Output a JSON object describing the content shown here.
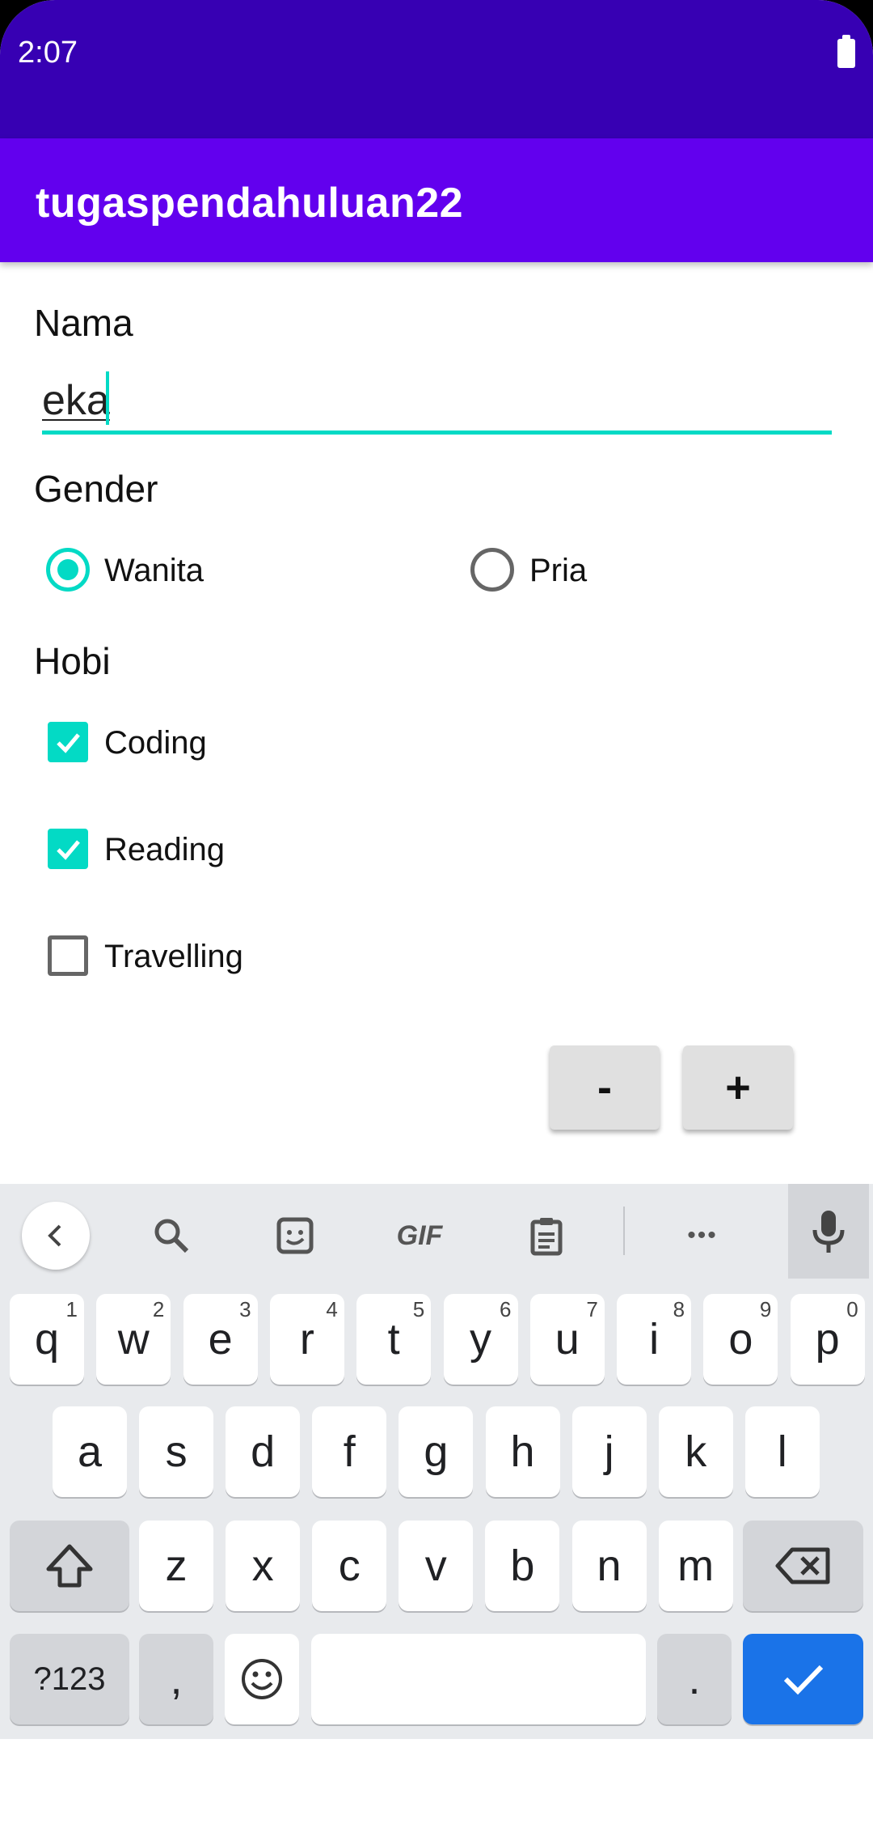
{
  "status_bar": {
    "time": "2:07"
  },
  "app_bar": {
    "title": "tugaspendahuluan22"
  },
  "form": {
    "name_label": "Nama",
    "name_value": "eka",
    "gender_label": "Gender",
    "gender_options": [
      {
        "label": "Wanita",
        "checked": true
      },
      {
        "label": "Pria",
        "checked": false
      }
    ],
    "hobby_label": "Hobi",
    "hobbies": [
      {
        "label": "Coding",
        "checked": true
      },
      {
        "label": "Reading",
        "checked": true
      },
      {
        "label": "Travelling",
        "checked": false
      }
    ],
    "minus_label": "-",
    "plus_label": "+"
  },
  "keyboard": {
    "toolbar": [
      "back-icon",
      "search-icon",
      "sticker-icon",
      "gif-icon",
      "clipboard-icon",
      "more-icon",
      "mic-icon"
    ],
    "gif_label": "GIF",
    "more_label": "•••",
    "row1": [
      {
        "k": "q",
        "h": "1"
      },
      {
        "k": "w",
        "h": "2"
      },
      {
        "k": "e",
        "h": "3"
      },
      {
        "k": "r",
        "h": "4"
      },
      {
        "k": "t",
        "h": "5"
      },
      {
        "k": "y",
        "h": "6"
      },
      {
        "k": "u",
        "h": "7"
      },
      {
        "k": "i",
        "h": "8"
      },
      {
        "k": "o",
        "h": "9"
      },
      {
        "k": "p",
        "h": "0"
      }
    ],
    "row2": [
      "a",
      "s",
      "d",
      "f",
      "g",
      "h",
      "j",
      "k",
      "l"
    ],
    "row3": [
      "z",
      "x",
      "c",
      "v",
      "b",
      "n",
      "m"
    ],
    "symbols_label": "?123",
    "comma_label": ",",
    "period_label": ".",
    "accent_color": "#1a73e8"
  },
  "colors": {
    "status_bar": "#3700b3",
    "app_bar": "#6200ee",
    "accent": "#03dac5"
  }
}
